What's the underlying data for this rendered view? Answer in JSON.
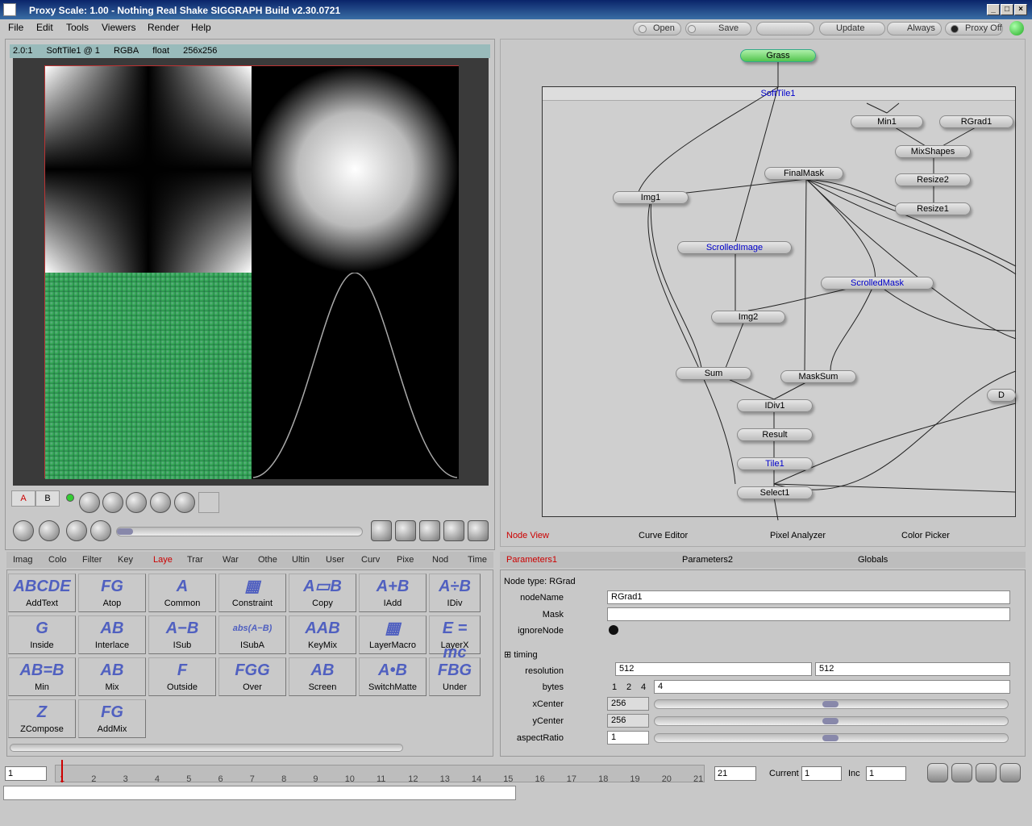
{
  "window": {
    "title": "Proxy Scale: 1.00 - Nothing Real Shake SIGGRAPH Build v2.30.0721"
  },
  "menu": [
    "File",
    "Edit",
    "Tools",
    "Viewers",
    "Render",
    "Help"
  ],
  "toolbar": {
    "open": "Open",
    "save": "Save",
    "update": "Update",
    "always": "Always",
    "proxy": "Proxy Off"
  },
  "viewer": {
    "zoom": "2.0:1",
    "node": "SoftTile1 @ 1",
    "channels": "RGBA",
    "depth": "float",
    "size": "256x256",
    "buffer_a": "A",
    "buffer_b": "B"
  },
  "nodeview": {
    "nodes": [
      {
        "name": "Grass",
        "style": "green"
      },
      {
        "name": "SoftTile1",
        "style": "blue"
      },
      {
        "name": "Min1",
        "style": ""
      },
      {
        "name": "RGrad1",
        "style": ""
      },
      {
        "name": "MixShapes",
        "style": ""
      },
      {
        "name": "FinalMask",
        "style": ""
      },
      {
        "name": "Resize2",
        "style": ""
      },
      {
        "name": "Img1",
        "style": ""
      },
      {
        "name": "Resize1",
        "style": ""
      },
      {
        "name": "ScrolledImage",
        "style": "blue"
      },
      {
        "name": "ScrolledMask",
        "style": "blue"
      },
      {
        "name": "Img2",
        "style": ""
      },
      {
        "name": "Sum",
        "style": ""
      },
      {
        "name": "MaskSum",
        "style": ""
      },
      {
        "name": "IDiv1",
        "style": ""
      },
      {
        "name": "Result",
        "style": ""
      },
      {
        "name": "Tile1",
        "style": "blue"
      },
      {
        "name": "Select1",
        "style": ""
      },
      {
        "name": "D",
        "style": ""
      }
    ],
    "tabs": [
      "Node View",
      "Curve Editor",
      "Pixel Analyzer",
      "Color Picker"
    ]
  },
  "tooltabs": [
    "Imag",
    "Colo",
    "Filter",
    "Key",
    "Laye",
    "Trar",
    "War",
    "Othe",
    "Ultin",
    "User",
    "Curv",
    "Pixe",
    "Nod",
    "Time"
  ],
  "tools": [
    {
      "label": "AddText",
      "icon": "ABCDE"
    },
    {
      "label": "Atop",
      "icon": "FG"
    },
    {
      "label": "Common",
      "icon": "A"
    },
    {
      "label": "Constraint",
      "icon": "▦"
    },
    {
      "label": "Copy",
      "icon": "A▭B"
    },
    {
      "label": "IAdd",
      "icon": "A+B"
    },
    {
      "label": "IDiv",
      "icon": "A÷B"
    },
    {
      "label": "Inside",
      "icon": "G"
    },
    {
      "label": "Interlace",
      "icon": "AB"
    },
    {
      "label": "ISub",
      "icon": "A−B"
    },
    {
      "label": "ISubA",
      "icon": "abs(A−B)"
    },
    {
      "label": "KeyMix",
      "icon": "AAB"
    },
    {
      "label": "LayerMacro",
      "icon": "▦"
    },
    {
      "label": "LayerX",
      "icon": "E = mc"
    },
    {
      "label": "Min",
      "icon": "AB=B"
    },
    {
      "label": "Mix",
      "icon": "AB"
    },
    {
      "label": "Outside",
      "icon": "F"
    },
    {
      "label": "Over",
      "icon": "FGG"
    },
    {
      "label": "Screen",
      "icon": "AB"
    },
    {
      "label": "SwitchMatte",
      "icon": "A•B"
    },
    {
      "label": "Under",
      "icon": "FBG"
    },
    {
      "label": "ZCompose",
      "icon": "Z"
    },
    {
      "label": "AddMix",
      "icon": "FG"
    }
  ],
  "params": {
    "tabs": [
      "Parameters1",
      "Parameters2",
      "Globals"
    ],
    "node_type": "Node type: RGrad",
    "nodeName_label": "nodeName",
    "nodeName": "RGrad1",
    "mask_label": "Mask",
    "mask": "",
    "ignore_label": "ignoreNode",
    "timing_label": "timing",
    "resolution_label": "resolution",
    "res_x": "512",
    "res_y": "512",
    "bytes_label": "bytes",
    "bytes_opts": [
      "1",
      "2",
      "4"
    ],
    "bytes": "4",
    "xcenter_label": "xCenter",
    "xcenter": "256",
    "ycenter_label": "yCenter",
    "ycenter": "256",
    "aspect_label": "aspectRatio",
    "aspect": "1"
  },
  "timeline": {
    "start": "1",
    "end": "21",
    "current_label": "Current",
    "current": "1",
    "inc_label": "Inc",
    "inc": "1",
    "ticks": [
      "1",
      "2",
      "3",
      "4",
      "5",
      "6",
      "7",
      "8",
      "9",
      "10",
      "11",
      "12",
      "13",
      "14",
      "15",
      "16",
      "17",
      "18",
      "19",
      "20",
      "21"
    ]
  }
}
